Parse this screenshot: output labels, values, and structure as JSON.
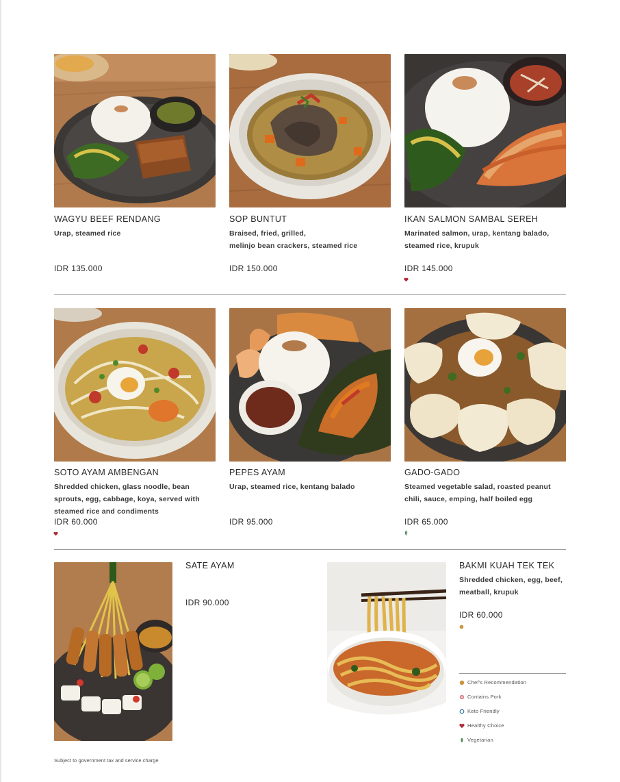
{
  "colors": {
    "chef": "#c9953a",
    "pork": "#d9848a",
    "keto": "#3e7fa0",
    "healthy": "#b02a37",
    "vegetarian": "#4f8a5c"
  },
  "items": [
    {
      "name": "WAGYU BEEF RENDANG",
      "desc": "Urap, steamed rice",
      "price": "IDR 135.000",
      "photo": "beef-rendang-photo"
    },
    {
      "name": "SOP BUNTUT",
      "desc": "Braised, fried, grilled,\nmelinjo bean crackers, steamed rice",
      "price": "IDR 150.000",
      "photo": "oxtail-soup-photo"
    },
    {
      "name": "IKAN SALMON SAMBAL SEREH",
      "desc": "Marinated salmon, urap, kentang balado,\nsteamed rice, krupuk",
      "price": "IDR 145.000",
      "photo": "salmon-photo",
      "badge": "healthy-choice-icon"
    },
    {
      "name": "SOTO AYAM AMBENGAN",
      "desc": "Shredded chicken, glass noodle, bean\nsprouts, egg, cabbage, koya, served with\nsteamed rice and condiments",
      "price": "IDR 60.000",
      "photo": "soto-ayam-photo",
      "badge": "healthy-choice-icon"
    },
    {
      "name": "PEPES AYAM",
      "desc": "Urap, steamed rice, kentang balado",
      "price": "IDR 95.000",
      "photo": "pepes-ayam-photo"
    },
    {
      "name": "GADO-GADO",
      "desc": "Steamed vegetable salad, roasted peanut\nchili, sauce, emping, half boiled egg",
      "price": "IDR 65.000",
      "photo": "gado-gado-photo",
      "badge": "vegetarian-icon"
    },
    {
      "name": "SATE AYAM",
      "desc": "",
      "price": "IDR 90.000",
      "photo": "sate-ayam-photo"
    },
    {
      "name": "BAKMI KUAH TEK TEK",
      "desc": "Shredded chicken, egg, beef,\nmeatball, krupuk",
      "price": "IDR 60.000",
      "photo": "bakmi-photo",
      "badge": "chefs-recommendation-icon"
    }
  ],
  "legend": [
    {
      "label": "Chef's Recommendation",
      "icon": "chefs-recommendation-icon"
    },
    {
      "label": "Contains Pork",
      "icon": "contains-pork-icon"
    },
    {
      "label": "Keto Friendly",
      "icon": "keto-friendly-icon"
    },
    {
      "label": "Healthy Choice",
      "icon": "healthy-choice-icon"
    },
    {
      "label": "Vegetarian",
      "icon": "vegetarian-icon"
    }
  ],
  "footnote": "Subject to government tax and service charge"
}
